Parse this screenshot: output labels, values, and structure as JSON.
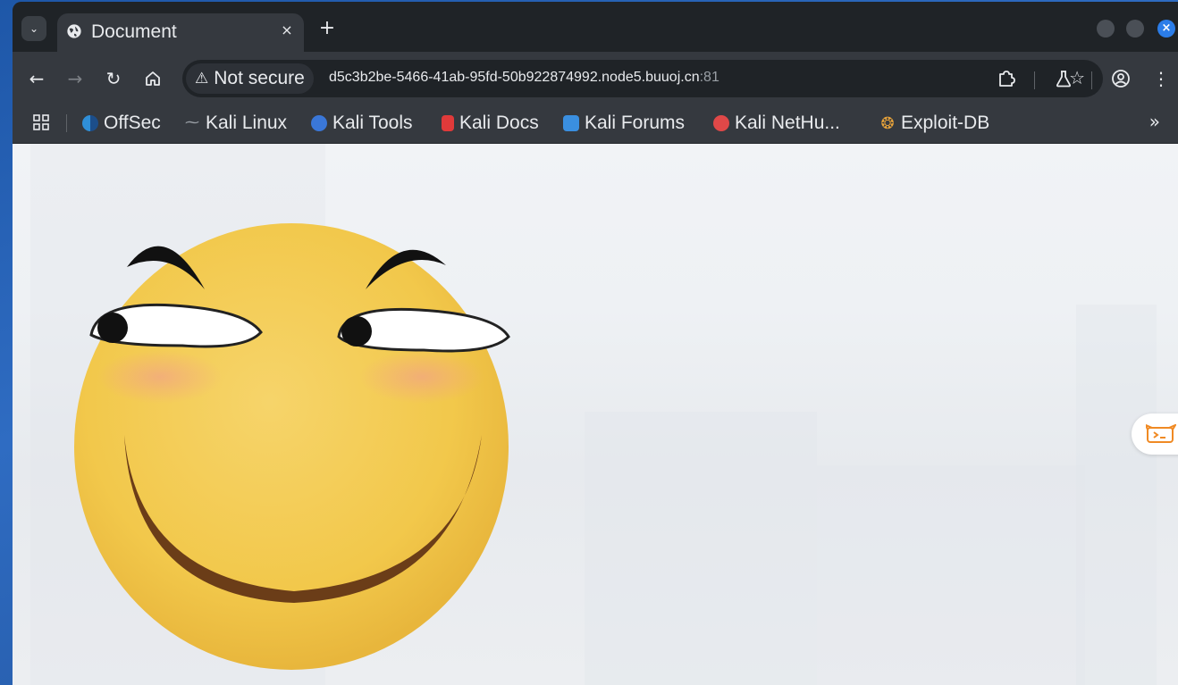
{
  "browser": {
    "tab": {
      "title": "Document",
      "close_label": "×",
      "icon": "globe-icon"
    },
    "new_tab_label": "+",
    "window_close_label": "×",
    "toolbar": {
      "back_icon": "arrow-left-icon",
      "forward_icon": "arrow-right-icon",
      "reload_icon": "reload-icon",
      "home_icon": "home-icon",
      "security_label": "Not secure",
      "url_host": "d5c3b2be-5466-41ab-95fd-50b922874992.node5.buuoj.cn",
      "url_port": ":81",
      "star_icon": "star-icon",
      "extensions_icon": "puzzle-icon",
      "labs_icon": "flask-icon",
      "profile_icon": "profile-icon",
      "menu_icon": "kebab-menu-icon"
    },
    "bookmarks": [
      {
        "label": "OffSec",
        "icon": "offsec-icon",
        "color": "#2f8fd8"
      },
      {
        "label": "Kali Linux",
        "icon": "kali-dragon-icon",
        "color": "#9aa0a6"
      },
      {
        "label": "Kali Tools",
        "icon": "kali-tools-icon",
        "color": "#3a77d8"
      },
      {
        "label": "Kali Docs",
        "icon": "kali-docs-icon",
        "color": "#e03a3a"
      },
      {
        "label": "Kali Forums",
        "icon": "kali-forums-icon",
        "color": "#3a8fe0"
      },
      {
        "label": "Kali NetHu...",
        "icon": "kali-nethunter-icon",
        "color": "#e04848"
      },
      {
        "label": "Exploit-DB",
        "icon": "exploit-db-icon",
        "color": "#e8a33a"
      }
    ],
    "bookmarks_more_label": "»"
  },
  "page": {
    "image": "smirking-emoji",
    "side_widget_icon": "terminal-cat-icon",
    "colors": {
      "face": "#f2c84b",
      "accent": "#f08a24"
    }
  }
}
